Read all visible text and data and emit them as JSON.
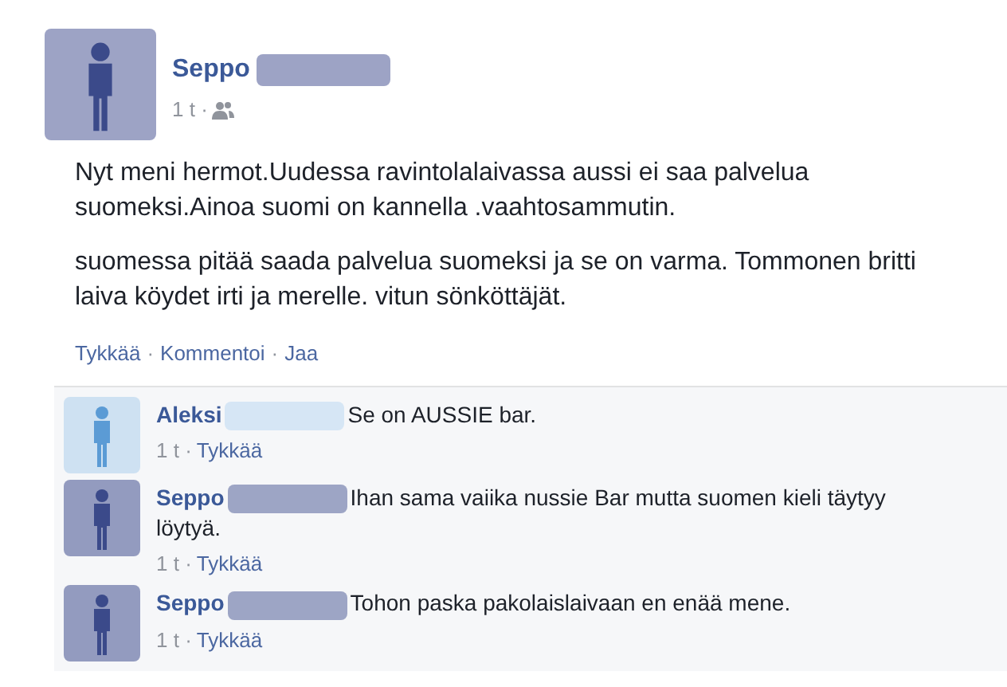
{
  "post": {
    "author": "Seppo",
    "time": "1 t ·",
    "paragraphs": [
      "Nyt meni hermot.Uudessa ravintolalaivassa aussi ei saa palvelua suomeksi.Ainoa suomi on kannella .vaahtosammutin.",
      "suomessa pitää saada palvelua suomeksi ja se on varma. Tommonen britti laiva köydet irti ja merelle. vitun sönköttäjät."
    ],
    "actions": [
      "Tykkää",
      "·",
      "Kommentoi",
      "·",
      "Jaa"
    ]
  },
  "comments": [
    {
      "author": "Aleksi",
      "text": "Se on AUSSIE bar.",
      "time": "1 t ·",
      "like": "Tykkää",
      "color": "#5b9bd5"
    },
    {
      "author": "Seppo",
      "text": "Ihan sama vaiika nussie Bar mutta suomen kieli täytyy löytyä.",
      "time": "1 t ·",
      "like": "Tykkää",
      "color": "#3b4a8a"
    },
    {
      "author": "Seppo",
      "text": "Tohon paska pakolaislaivaan en enää mene.",
      "time": "1 t ·",
      "like": "Tykkää",
      "color": "#3b4a8a"
    }
  ]
}
